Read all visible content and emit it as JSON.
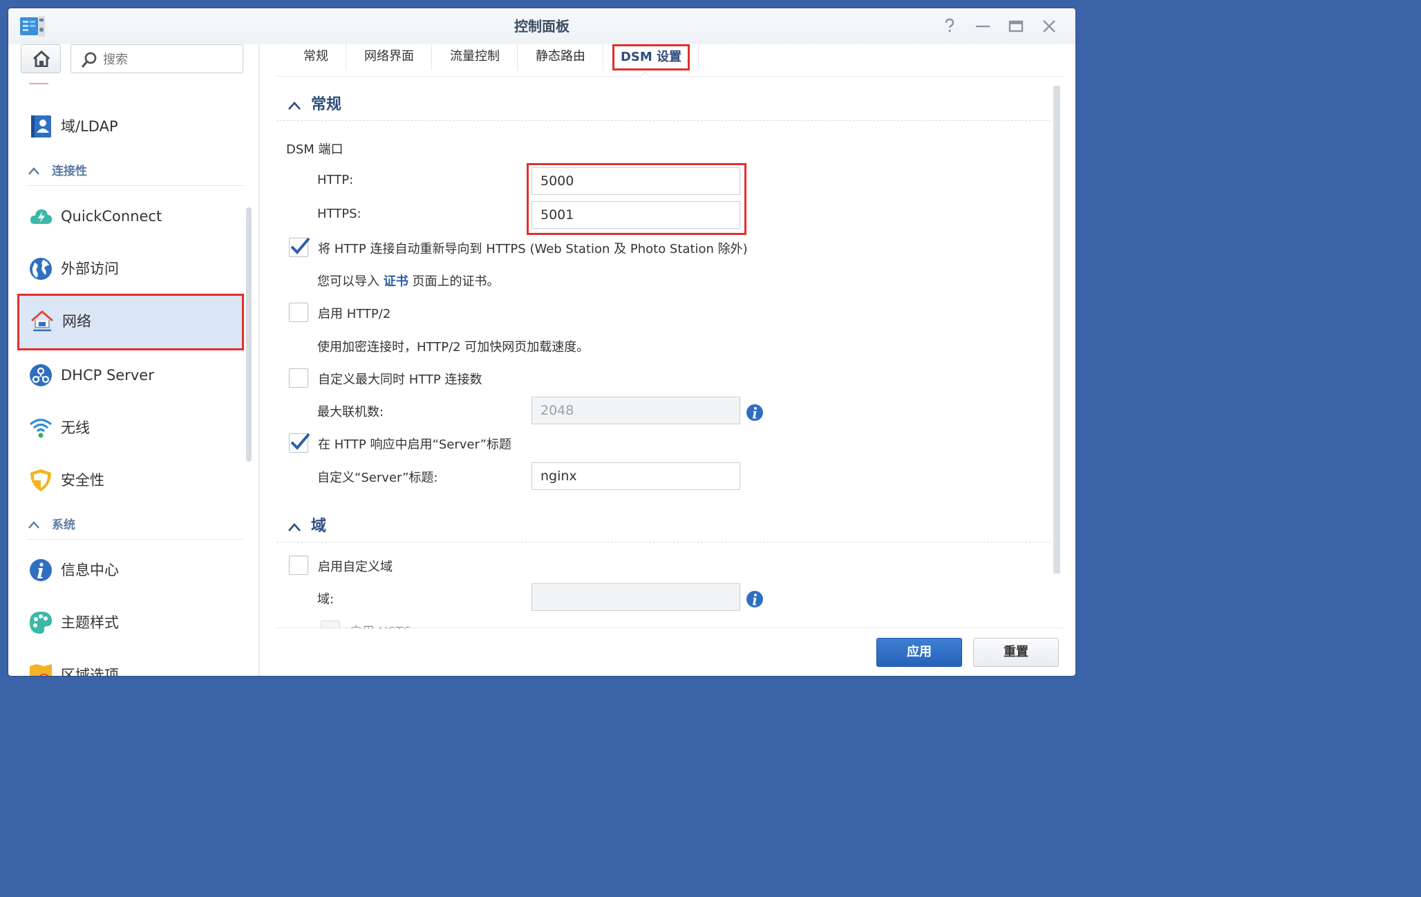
{
  "window": {
    "title": "控制面板"
  },
  "search": {
    "placeholder": "搜索"
  },
  "sidebar": {
    "items_top": [
      {
        "label": "域/LDAP",
        "icon": "directory-user-icon"
      }
    ],
    "sections": [
      {
        "label": "连接性",
        "items": [
          {
            "label": "QuickConnect",
            "icon": "quickconnect-cloud-icon"
          },
          {
            "label": "外部访问",
            "icon": "external-access-globe-icon"
          },
          {
            "label": "网络",
            "icon": "network-house-icon",
            "active": true
          },
          {
            "label": "DHCP Server",
            "icon": "dhcp-server-icon"
          },
          {
            "label": "无线",
            "icon": "wireless-icon"
          },
          {
            "label": "安全性",
            "icon": "security-shield-icon"
          }
        ]
      },
      {
        "label": "系统",
        "items": [
          {
            "label": "信息中心",
            "icon": "info-center-icon"
          },
          {
            "label": "主题样式",
            "icon": "theme-palette-icon"
          },
          {
            "label": "区域选项",
            "icon": "regional-options-icon"
          }
        ]
      }
    ]
  },
  "tabs": [
    {
      "label": "常规"
    },
    {
      "label": "网络界面"
    },
    {
      "label": "流量控制"
    },
    {
      "label": "静态路由"
    },
    {
      "label": "DSM 设置",
      "active": true
    }
  ],
  "general": {
    "heading": "常规",
    "dsm_port_label": "DSM 端口",
    "http_label": "HTTP:",
    "http_value": "5000",
    "https_label": "HTTPS:",
    "https_value": "5001",
    "redirect_checked": true,
    "redirect_label": "将 HTTP 连接自动重新导向到 HTTPS (Web Station 及 Photo Station 除外)",
    "cert_hint_prefix": "您可以导入",
    "cert_hint_link": "证书",
    "cert_hint_suffix": "页面上的证书。",
    "http2_checked": false,
    "http2_label": "启用 HTTP/2",
    "http2_hint": "使用加密连接时，HTTP/2 可加快网页加载速度。",
    "max_conn_checked": false,
    "max_conn_label": "自定义最大同时 HTTP 连接数",
    "max_conn_field_label": "最大联机数:",
    "max_conn_value": "2048",
    "server_header_checked": true,
    "server_header_label": "在 HTTP 响应中启用“Server”标题",
    "custom_server_label": "自定义“Server”标题:",
    "custom_server_value": "nginx"
  },
  "domain": {
    "heading": "域",
    "custom_domain_checked": false,
    "custom_domain_label": "启用自定义域",
    "domain_field_label": "域:",
    "domain_value": "",
    "hsts_label": "启用 HSTS"
  },
  "footer": {
    "apply_label": "应用",
    "reset_label": "重置"
  },
  "colors": {
    "accent": "#2563b8",
    "highlight": "#e0302a",
    "heading": "#2f4d7e"
  }
}
